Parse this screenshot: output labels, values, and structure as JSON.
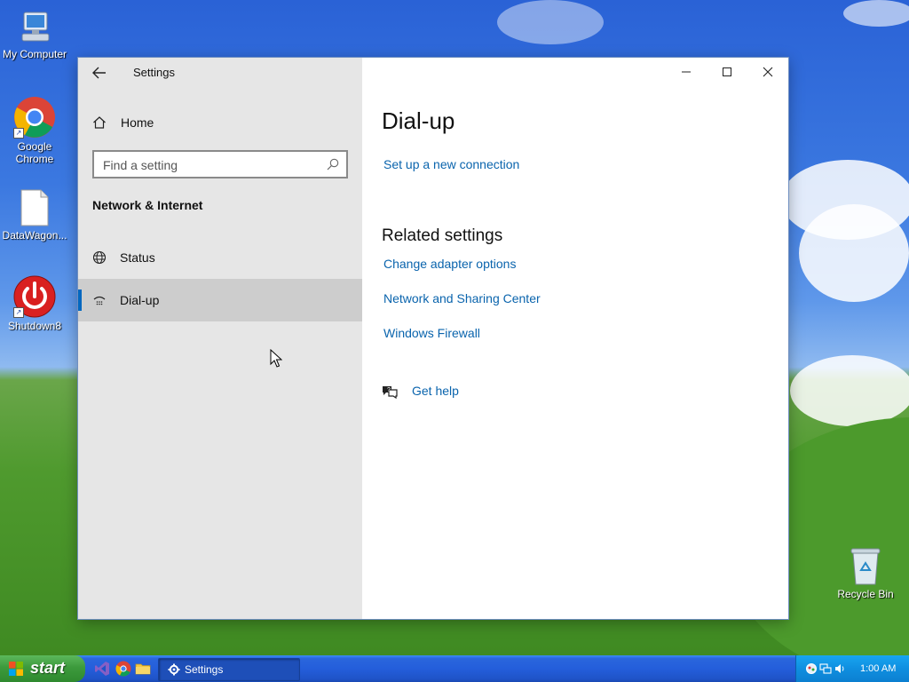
{
  "desktop": {
    "icons": [
      {
        "label": "My Computer"
      },
      {
        "label": "Google Chrome"
      },
      {
        "label": "DataWagon..."
      },
      {
        "label": "Shutdown8"
      },
      {
        "label": "Recycle Bin"
      }
    ]
  },
  "settings": {
    "app_title": "Settings",
    "back_icon": "back-arrow-icon",
    "home_label": "Home",
    "search": {
      "placeholder": "Find a setting",
      "value": ""
    },
    "section_heading": "Network & Internet",
    "nav_items": [
      {
        "label": "Status",
        "icon": "globe-icon",
        "selected": false
      },
      {
        "label": "Dial-up",
        "icon": "dialup-icon",
        "selected": true
      }
    ],
    "window_controls": [
      "minimize",
      "maximize",
      "close"
    ],
    "accent_color": "#0067c0",
    "link_color": "#0a64ad"
  },
  "page": {
    "title": "Dial-up",
    "setup_link": "Set up a new connection",
    "related_heading": "Related settings",
    "related_links": [
      "Change adapter options",
      "Network and Sharing Center",
      "Windows Firewall"
    ],
    "help_label": "Get help"
  },
  "taskbar": {
    "start_label": "start",
    "active_task": "Settings",
    "clock": "1:00 AM"
  }
}
